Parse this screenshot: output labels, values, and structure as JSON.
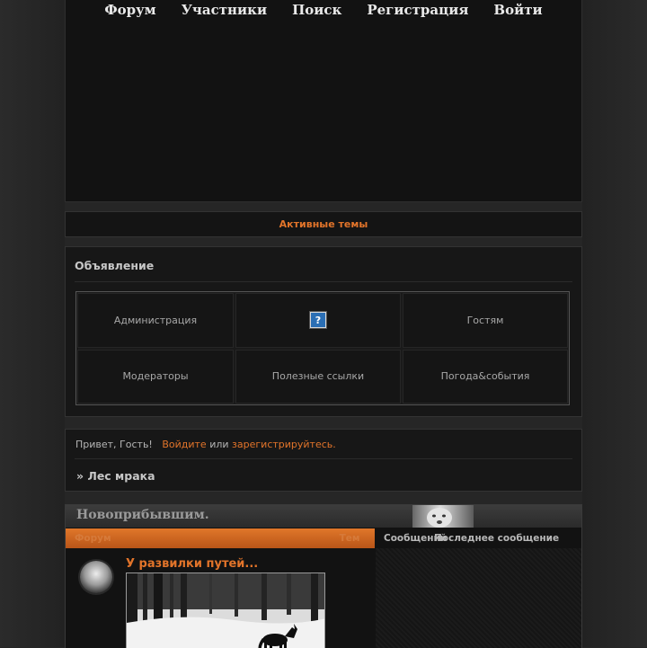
{
  "nav": {
    "items": [
      {
        "label": "Форум"
      },
      {
        "label": "Участники"
      },
      {
        "label": "Поиск"
      },
      {
        "label": "Регистрация"
      },
      {
        "label": "Войти"
      }
    ]
  },
  "active_topics": {
    "label": "Активные темы"
  },
  "announcement": {
    "title": "Объявление",
    "cells": [
      {
        "label": "Администрация"
      },
      {
        "label": "",
        "icon": "question-icon"
      },
      {
        "label": "Гостям"
      },
      {
        "label": "Модераторы"
      },
      {
        "label": "Полезные ссылки"
      },
      {
        "label": "Погода&события"
      }
    ],
    "question_glyph": "?"
  },
  "welcome": {
    "greeting": "Привет, Гость!",
    "login_link": "Войдите",
    "or_text": "или",
    "register_link": "зарегистрируйтесь."
  },
  "breadcrumb": {
    "prefix": "»",
    "label": "Лес мрака"
  },
  "category": {
    "title": "Новоприбывшим.",
    "columns": {
      "forum": "Форум",
      "topics": "Тем",
      "posts": "Сообщений",
      "last_post": "Последнее сообщение"
    },
    "forums": [
      {
        "title": "У развилки путей..."
      }
    ]
  },
  "colors": {
    "accent": "#e2742a",
    "background": "#262626",
    "panel": "#171717"
  }
}
